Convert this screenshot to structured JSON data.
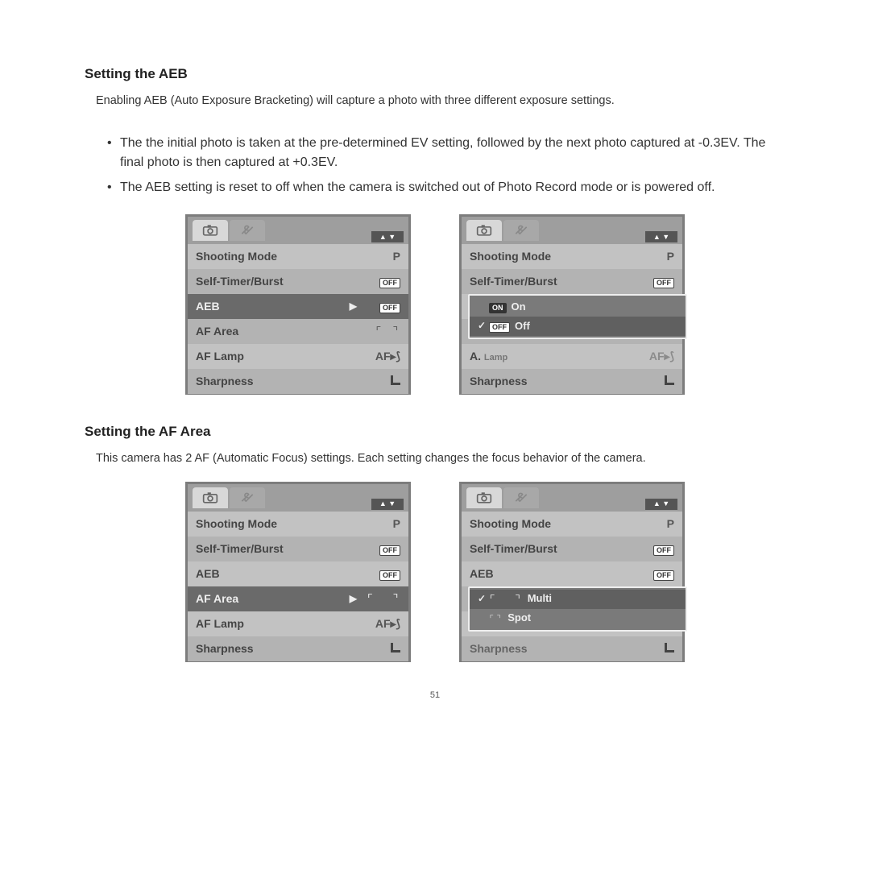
{
  "page_number": "51",
  "section1": {
    "heading": "Setting the AEB",
    "intro": "Enabling AEB (Auto Exposure Bracketing) will capture a photo with three different exposure settings.",
    "bullets": [
      "The the initial photo is taken at the pre-determined EV setting, followed by the next photo captured at -0.3EV. The final photo is then captured at +0.3EV.",
      "The AEB setting is reset to off when the camera is switched out of Photo Record mode or is powered off."
    ]
  },
  "section2": {
    "heading": "Setting the AF Area",
    "intro": "This camera has 2 AF (Automatic Focus) settings. Each setting changes the focus behavior of the camera."
  },
  "menu": {
    "nav_arrows": "▲ ▼",
    "shooting_mode": "Shooting Mode",
    "shooting_mode_val": "P",
    "self_timer": "Self-Timer/Burst",
    "off_pill": "OFF",
    "on_pill": "ON",
    "aeb": "AEB",
    "af_area": "AF Area",
    "af_lamp": "AF Lamp",
    "af_lamp_val": "AF⦆⦅",
    "sharpness": "Sharpness",
    "arrow_right": "▶"
  },
  "popup_aeb": {
    "on": "On",
    "off": "Off"
  },
  "popup_af": {
    "multi": "Multi",
    "spot": "Spot"
  }
}
